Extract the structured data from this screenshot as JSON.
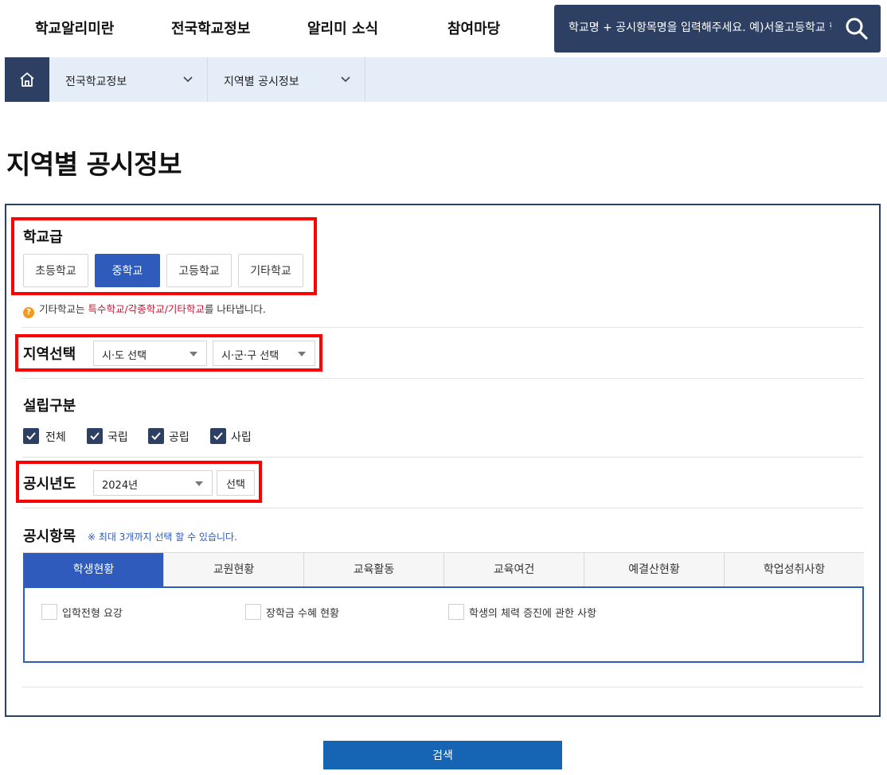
{
  "nav": {
    "menu": [
      "학교알리미란",
      "전국학교정보",
      "알리미 소식",
      "참여마당"
    ],
    "search_placeholder": "학교명 + 공시항목명을 입력해주세요. 예)서울고등학교 학생현황"
  },
  "breadcrumb": [
    "전국학교정보",
    "지역별 공시정보"
  ],
  "page_title": "지역별 공시정보",
  "school_level": {
    "label": "학교급",
    "options": [
      "초등학교",
      "중학교",
      "고등학교",
      "기타학교"
    ],
    "selected": "중학교",
    "note_prefix": "기타학교는 ",
    "note_highlight": "특수학교/각종학교/기타학교",
    "note_suffix": "를 나타냅니다."
  },
  "region": {
    "label": "지역선택",
    "sido": "시·도 선택",
    "sigungu": "시·군·구 선택"
  },
  "founding": {
    "label": "설립구분",
    "options": [
      {
        "label": "전체",
        "checked": true
      },
      {
        "label": "국립",
        "checked": true
      },
      {
        "label": "공립",
        "checked": true
      },
      {
        "label": "사립",
        "checked": true
      }
    ]
  },
  "year": {
    "label": "공시년도",
    "value": "2024년",
    "select_button": "선택"
  },
  "items": {
    "label": "공시항목",
    "hint": "※ 최대 3개까지 선택 할 수 있습니다.",
    "tabs": [
      "학생현황",
      "교원현황",
      "교육활동",
      "교육여건",
      "예결산현황",
      "학업성취사항"
    ],
    "active_tab": "학생현황",
    "options": [
      "입학전형 요강",
      "장학금 수혜 현황",
      "학생의 체력 증진에 관한 사항"
    ]
  },
  "submit_label": "검색",
  "colors": {
    "navy": "#2d3f63",
    "accent_blue": "#2f5bbd",
    "submit_blue": "#1565b4",
    "highlight_red": "#ff0000",
    "note_red": "#c8102e"
  }
}
